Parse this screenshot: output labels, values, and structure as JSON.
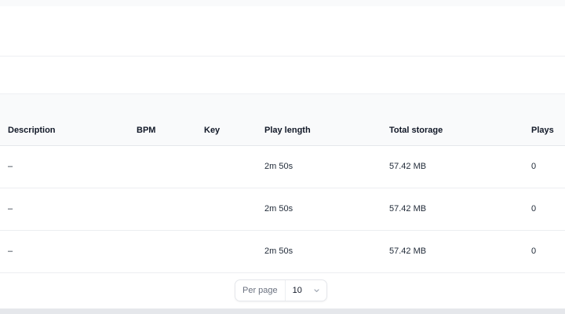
{
  "table": {
    "columns": [
      "Description",
      "BPM",
      "Key",
      "Play length",
      "Total storage",
      "Plays"
    ],
    "rows": [
      {
        "description": "–",
        "bpm": "",
        "key": "",
        "play_length": "2m 50s",
        "total_storage": "57.42 MB",
        "plays": "0"
      },
      {
        "description": "–",
        "bpm": "",
        "key": "",
        "play_length": "2m 50s",
        "total_storage": "57.42 MB",
        "plays": "0"
      },
      {
        "description": "–",
        "bpm": "",
        "key": "",
        "play_length": "2m 50s",
        "total_storage": "57.42 MB",
        "plays": "0"
      }
    ]
  },
  "pagination": {
    "per_page_label": "Per page",
    "per_page_value": "10",
    "chevron_icon": "chevron-down-icon"
  }
}
